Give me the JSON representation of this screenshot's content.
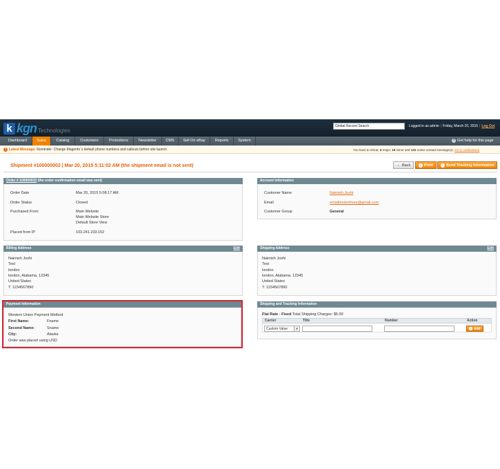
{
  "header": {
    "logo_k": "k",
    "logo_brand": "kgn",
    "logo_sub": "Technologies",
    "search_value": "Global Record Search",
    "logged_in": "Logged in as admin",
    "date": "Friday, March 20, 2015",
    "logout": "Log Out"
  },
  "nav": {
    "items": [
      "Dashboard",
      "Sales",
      "Catalog",
      "Customers",
      "Promotions",
      "Newsletter",
      "CMS",
      "Sell On eBay",
      "Reports",
      "System"
    ],
    "active": "Sales",
    "help": "Get help for this page"
  },
  "notice": {
    "label": "Latest Message:",
    "text": "Reminder: Change Magento`s default phone numbers and callouts before site launch",
    "right_prefix": "You have",
    "critical_count": "1",
    "critical": "critical,",
    "major_count": "6",
    "major": "major,",
    "minor_count": "19",
    "minor": "minor and",
    "notice_count": "131",
    "notice_tail": "notice unread message(s).",
    "link": "Go to notifications"
  },
  "page": {
    "title": "Shipment #100000002 | Mar 20, 2015 5:11:02 AM (the shipment email is not sent)",
    "back": "Back",
    "print": "Print",
    "send": "Send Tracking Information"
  },
  "order": {
    "heading_link": "Order # 100000033",
    "heading_tail": "(the order confirmation email was sent)",
    "date_label": "Order Date",
    "date_value": "Mar 20, 2015 5:08:17 AM",
    "status_label": "Order Status",
    "status_value": "Closed",
    "purchased_label": "Purchased From",
    "purchased_lines": [
      "Main Website",
      "Main Website Store",
      "Default Store View"
    ],
    "ip_label": "Placed from IP",
    "ip_value": "103.241.233.152"
  },
  "account": {
    "heading": "Account Information",
    "name_label": "Customer Name",
    "name_value": "Naimish Joshi",
    "email_label": "Email",
    "email_value": "emailtestenthree@gmail.com",
    "group_label": "Customer Group",
    "group_value": "General"
  },
  "billing": {
    "heading": "Billing Address",
    "edit": "Edit",
    "lines": [
      "Naimish Joshi",
      "Test",
      "london",
      "london, Alabama, 12345",
      "United States",
      "T: 1234567890"
    ]
  },
  "shipping": {
    "heading": "Shipping Address",
    "edit": "Edit",
    "lines": [
      "Naimish Joshi",
      "Test",
      "london",
      "london, Alabama, 12345",
      "United States",
      "T: 1234567890"
    ]
  },
  "payment": {
    "heading": "Payment Information",
    "method": "Western Union Payment Method",
    "first_label": "First Name:",
    "first_value": "Fname",
    "second_label": "Second Name:",
    "second_value": "Sname",
    "city_label": "City:",
    "city_value": "Alaska",
    "currency_note": "Order was placed using USD"
  },
  "tracking": {
    "heading": "Shipping and Tracking Information",
    "rate_bold": "Flat Rate - Fixed",
    "rate_tail": "Total Shipping Charges: $5.00",
    "col_carrier": "Carrier",
    "col_title": "Title",
    "col_number": "Number",
    "col_action": "Action",
    "carrier_value": "Custom Value",
    "add": "Add"
  },
  "colors": {
    "accent": "#f18200",
    "title": "#eb5e00",
    "box_head": "#6f8992",
    "highlight": "#d62431"
  }
}
